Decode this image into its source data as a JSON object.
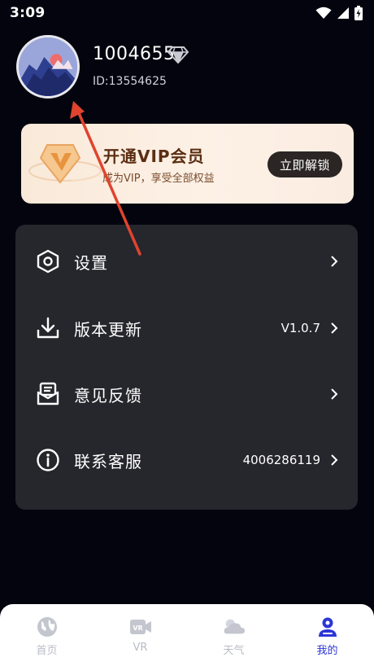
{
  "status_bar": {
    "time": "3:09",
    "icons": [
      "wifi-icon",
      "signal-icon",
      "battery-charging-icon"
    ]
  },
  "profile": {
    "username": "1004655",
    "user_id": "ID:13554625",
    "badge_icon": "diamond-icon"
  },
  "vip": {
    "title": "开通VIP会员",
    "subtitle": "成为VIP，享受全部权益",
    "button_label": "立即解锁",
    "badge_icon": "vip-shield-icon"
  },
  "menu": {
    "items": [
      {
        "label": "设置",
        "value": "",
        "icon": "settings-hexagon-icon"
      },
      {
        "label": "版本更新",
        "value": "V1.0.7",
        "icon": "download-icon"
      },
      {
        "label": "意见反馈",
        "value": "",
        "icon": "feedback-inbox-icon"
      },
      {
        "label": "联系客服",
        "value": "4006286119",
        "icon": "info-icon"
      }
    ]
  },
  "bottom_nav": {
    "items": [
      {
        "label": "首页",
        "icon": "globe-icon",
        "active": false
      },
      {
        "label": "VR",
        "icon": "vr-camera-icon",
        "active": false
      },
      {
        "label": "天气",
        "icon": "weather-cloud-icon",
        "active": false
      },
      {
        "label": "我的",
        "icon": "user-icon",
        "active": true
      }
    ]
  },
  "colors": {
    "background": "#03040d",
    "card": "#26262d",
    "accent": "#2b36d6",
    "vip_text": "#5b2e12",
    "annotation": "#e0442e"
  }
}
